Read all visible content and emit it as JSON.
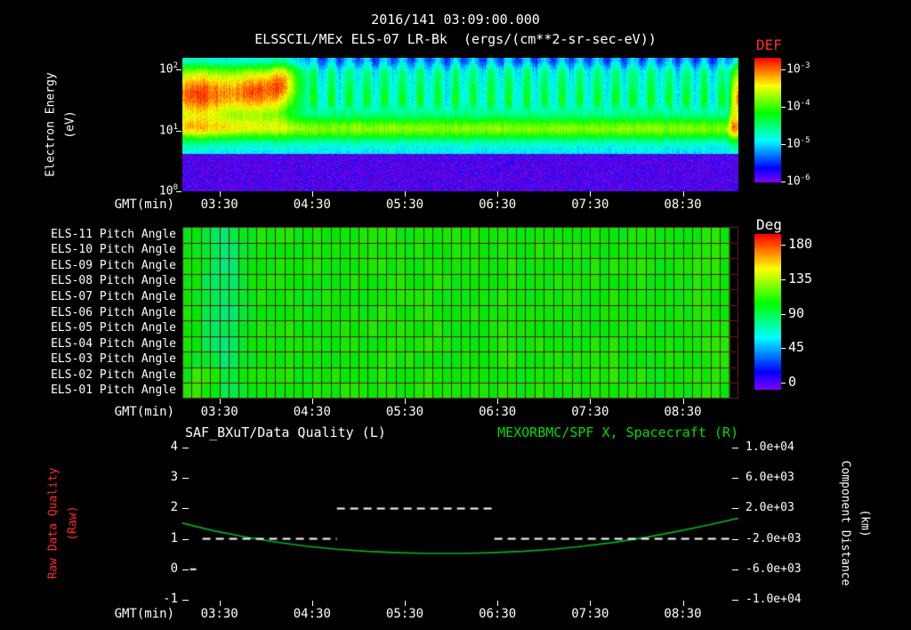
{
  "title": "2016/141 03:09:00.000",
  "subtitle": "ELSSCIL/MEx ELS-07 LR-Bk  (ergs/(cm**2-sr-sec-eV))",
  "time_axis": {
    "label": "GMT(min)",
    "start_gmt": "03:09:00",
    "duration_min": 360,
    "ticks": [
      "03:30",
      "04:30",
      "05:30",
      "06:30",
      "07:30",
      "08:30"
    ],
    "tick_offsets_min": [
      24,
      84,
      144,
      204,
      264,
      324
    ]
  },
  "spectrogram": {
    "ylabel_line1": "Electron Energy",
    "ylabel_line2": "(eV)",
    "ytick_exponents": [
      2,
      1,
      0
    ],
    "colorbar_title": "DEF",
    "colorbar_exponents": [
      -3,
      -4,
      -5,
      -6
    ]
  },
  "pitch": {
    "row_labels": [
      "ELS-11 Pitch Angle",
      "ELS-10 Pitch Angle",
      "ELS-09 Pitch Angle",
      "ELS-08 Pitch Angle",
      "ELS-07 Pitch Angle",
      "ELS-06 Pitch Angle",
      "ELS-05 Pitch Angle",
      "ELS-04 Pitch Angle",
      "ELS-03 Pitch Angle",
      "ELS-02 Pitch Angle",
      "ELS-01 Pitch Angle"
    ],
    "colorbar_title": "Deg",
    "colorbar_ticks": [
      "180",
      "135",
      "90",
      "45",
      "0"
    ]
  },
  "bottom": {
    "left_title": "SAF_BXuT/Data Quality (L)",
    "right_title": "MEXORBMC/SPF X, Spacecraft (R)",
    "left_label_line1": "Raw Data Quality",
    "left_label_line2": "(Raw)",
    "right_label_line1": "Component Distance",
    "right_label_line2": "(km)",
    "left_ticks": [
      "4",
      "3",
      "2",
      "1",
      "0",
      "-1"
    ],
    "right_ticks": [
      "1.0e+04",
      "6.0e+03",
      "2.0e+03",
      "-2.0e+03",
      "-6.0e+03",
      "-1.0e+04"
    ]
  },
  "colors": {
    "background": "#000000",
    "text": "#ffffff",
    "red_label": "#ff2a2a",
    "green_label": "#00dc00",
    "curve_green": "#00b41e",
    "dash_white": "#ffffff",
    "grid_red": "#641818"
  },
  "chart_data": [
    {
      "type": "heatmap",
      "name": "electron_energy_flux_spectrogram",
      "instrument": "ELSSCIL/MEx ELS-07 LR-Bk",
      "units": "ergs/(cm**2-sr-sec-eV)",
      "x_start_gmt": "03:09",
      "x_end_gmt": "09:09",
      "x_tick_labels": [
        "03:30",
        "04:30",
        "05:30",
        "06:30",
        "07:30",
        "08:30"
      ],
      "y_label": "Electron Energy (eV)",
      "y_scale": "log",
      "y_range_ev": [
        1,
        155
      ],
      "colorbar_log10_range": [
        -6,
        -3
      ],
      "render": {
        "e_top_log10": 2.19,
        "base": -5.05,
        "band": {
          "c": 1.02,
          "s": 0.13,
          "a": 0.95
        },
        "mid": {
          "c": 1.6,
          "s": 0.4,
          "a": 0.3
        },
        "low_e_cut": 0.62,
        "low_level": -5.7,
        "low_noise": 1.1,
        "left": {
          "t_end": 80,
          "fade": 18,
          "c": 1.62,
          "s": 0.33,
          "a": 1.05
        },
        "patches": [
          {
            "t": 12,
            "st": 13,
            "e": 1.5,
            "se": 0.4,
            "a": 0.55
          },
          {
            "t": 47,
            "st": 9,
            "e": 1.65,
            "se": 0.3,
            "a": 0.5
          },
          {
            "t": 66,
            "st": 7,
            "e": 1.85,
            "se": 0.22,
            "a": 0.6
          }
        ],
        "stripes": {
          "t_start": 82,
          "period": 11.5,
          "a": 0.26,
          "e0": 1.28,
          "e1": 1.5,
          "streak_a": 0.22,
          "streak_e": 1.45,
          "streak_se": 0.14
        },
        "right_edge": {
          "t_start": 353,
          "ramp": 3,
          "a": 1.15,
          "c": 1.5,
          "s": 0.45
        },
        "top_dim": {
          "e0": 1.95,
          "e1": 2.15,
          "a": 0.35
        },
        "noise": 0.32,
        "col_noise": 0.22
      }
    },
    {
      "type": "heatmap",
      "name": "pitch_angle_panels",
      "row_labels": [
        "ELS-11",
        "ELS-10",
        "ELS-09",
        "ELS-08",
        "ELS-07",
        "ELS-06",
        "ELS-05",
        "ELS-04",
        "ELS-03",
        "ELS-02",
        "ELS-01"
      ],
      "value_units": "deg",
      "colorbar_range": [
        0,
        180
      ],
      "typical_value_deg": 100,
      "render": {
        "cols": 60,
        "base_deg": 101,
        "noise_deg": 9,
        "cool_patch": {
          "center_col": 4,
          "sigma": 1.8,
          "delta_deg": -18
        },
        "warm_patch": {
          "rows": [
            9,
            10
          ],
          "cols": [
            1,
            3
          ],
          "delta_deg": 9
        },
        "gap_last_col": true
      }
    },
    {
      "type": "line",
      "name": "data_quality_and_spacecraft_x",
      "x_unit": "minutes_from_03:09",
      "x_tick_labels": [
        "03:30",
        "04:30",
        "05:30",
        "06:30",
        "07:30",
        "08:30"
      ],
      "left_axis": {
        "label": "Raw Data Quality (Raw)",
        "range": [
          -1,
          4
        ]
      },
      "right_axis": {
        "label": "Component Distance (km)",
        "range": [
          -10000,
          10000
        ]
      },
      "series": [
        {
          "name": "SAF_BXuT/Data Quality (L)",
          "axis": "left",
          "style": "white_dashed",
          "steps": [
            {
              "value": 0,
              "t_min": [
                5,
                9
              ]
            },
            {
              "value": 1,
              "t_min": [
                13,
                100
              ]
            },
            {
              "value": 2,
              "t_min": [
                100,
                202
              ]
            },
            {
              "value": 1,
              "t_min": [
                202,
                354
              ]
            }
          ]
        },
        {
          "name": "MEXORBMC/SPF X, Spacecraft (R)",
          "axis": "left",
          "style": "green_solid",
          "points": [
            [
              0,
              1.52
            ],
            [
              20,
              1.27
            ],
            [
              40,
              1.07
            ],
            [
              60,
              0.9
            ],
            [
              80,
              0.76
            ],
            [
              100,
              0.66
            ],
            [
              120,
              0.59
            ],
            [
              140,
              0.545
            ],
            [
              160,
              0.52
            ],
            [
              180,
              0.52
            ],
            [
              200,
              0.545
            ],
            [
              220,
              0.59
            ],
            [
              240,
              0.66
            ],
            [
              260,
              0.76
            ],
            [
              280,
              0.89
            ],
            [
              300,
              1.05
            ],
            [
              320,
              1.24
            ],
            [
              340,
              1.45
            ],
            [
              360,
              1.68
            ]
          ]
        }
      ]
    }
  ]
}
